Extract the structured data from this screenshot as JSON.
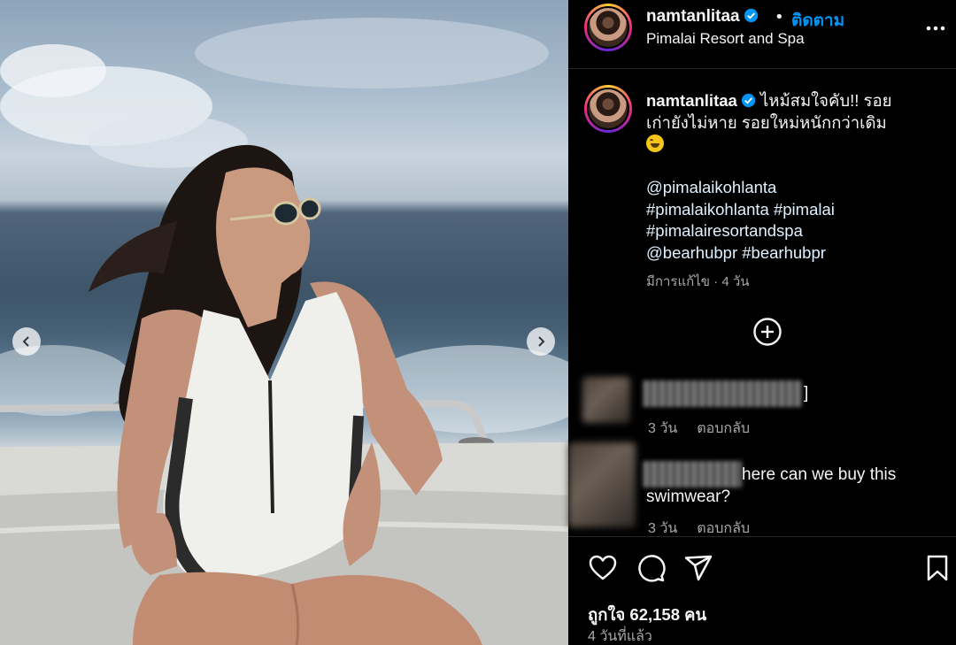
{
  "post": {
    "username": "namtanlitaa",
    "follow_label": "ติดตาม",
    "location": "Pimalai Resort and Spa",
    "caption_line1": "ไหม้สมใจคับ!! รอย",
    "caption_line2": "เก่ายังไม่หาย รอยใหม่หนักกว่าเดิม",
    "caption_tags": [
      "@pimalaikohlanta",
      "#pimalaikohlanta #pimalai",
      "#pimalairesortandspa",
      "@bearhubpr #bearhubpr"
    ],
    "edited_label": "มีการแก้ไข · 4 วัน",
    "likes_label": "ถูกใจ 62,158 คน",
    "time_ago": "4 วันที่แล้ว"
  },
  "comments": [
    {
      "text": "]",
      "time": "3 วัน",
      "reply_label": "ตอบกลับ"
    },
    {
      "text": "here can we buy this swimwear?",
      "time": "3 วัน",
      "reply_label": "ตอบกลับ"
    }
  ],
  "icons": {
    "verified": "verified-badge-icon",
    "more": "more-options-icon",
    "load_more": "plus-circle-icon",
    "like": "heart-icon",
    "comment": "comment-bubble-icon",
    "share": "paper-plane-icon",
    "save": "bookmark-icon",
    "prev": "chevron-left-icon",
    "next": "chevron-right-icon"
  },
  "colors": {
    "background": "#000000",
    "link_blue": "#0095f6",
    "verified_blue": "#0095f6",
    "secondary_text": "#a8a8a8",
    "divider": "#262626"
  }
}
